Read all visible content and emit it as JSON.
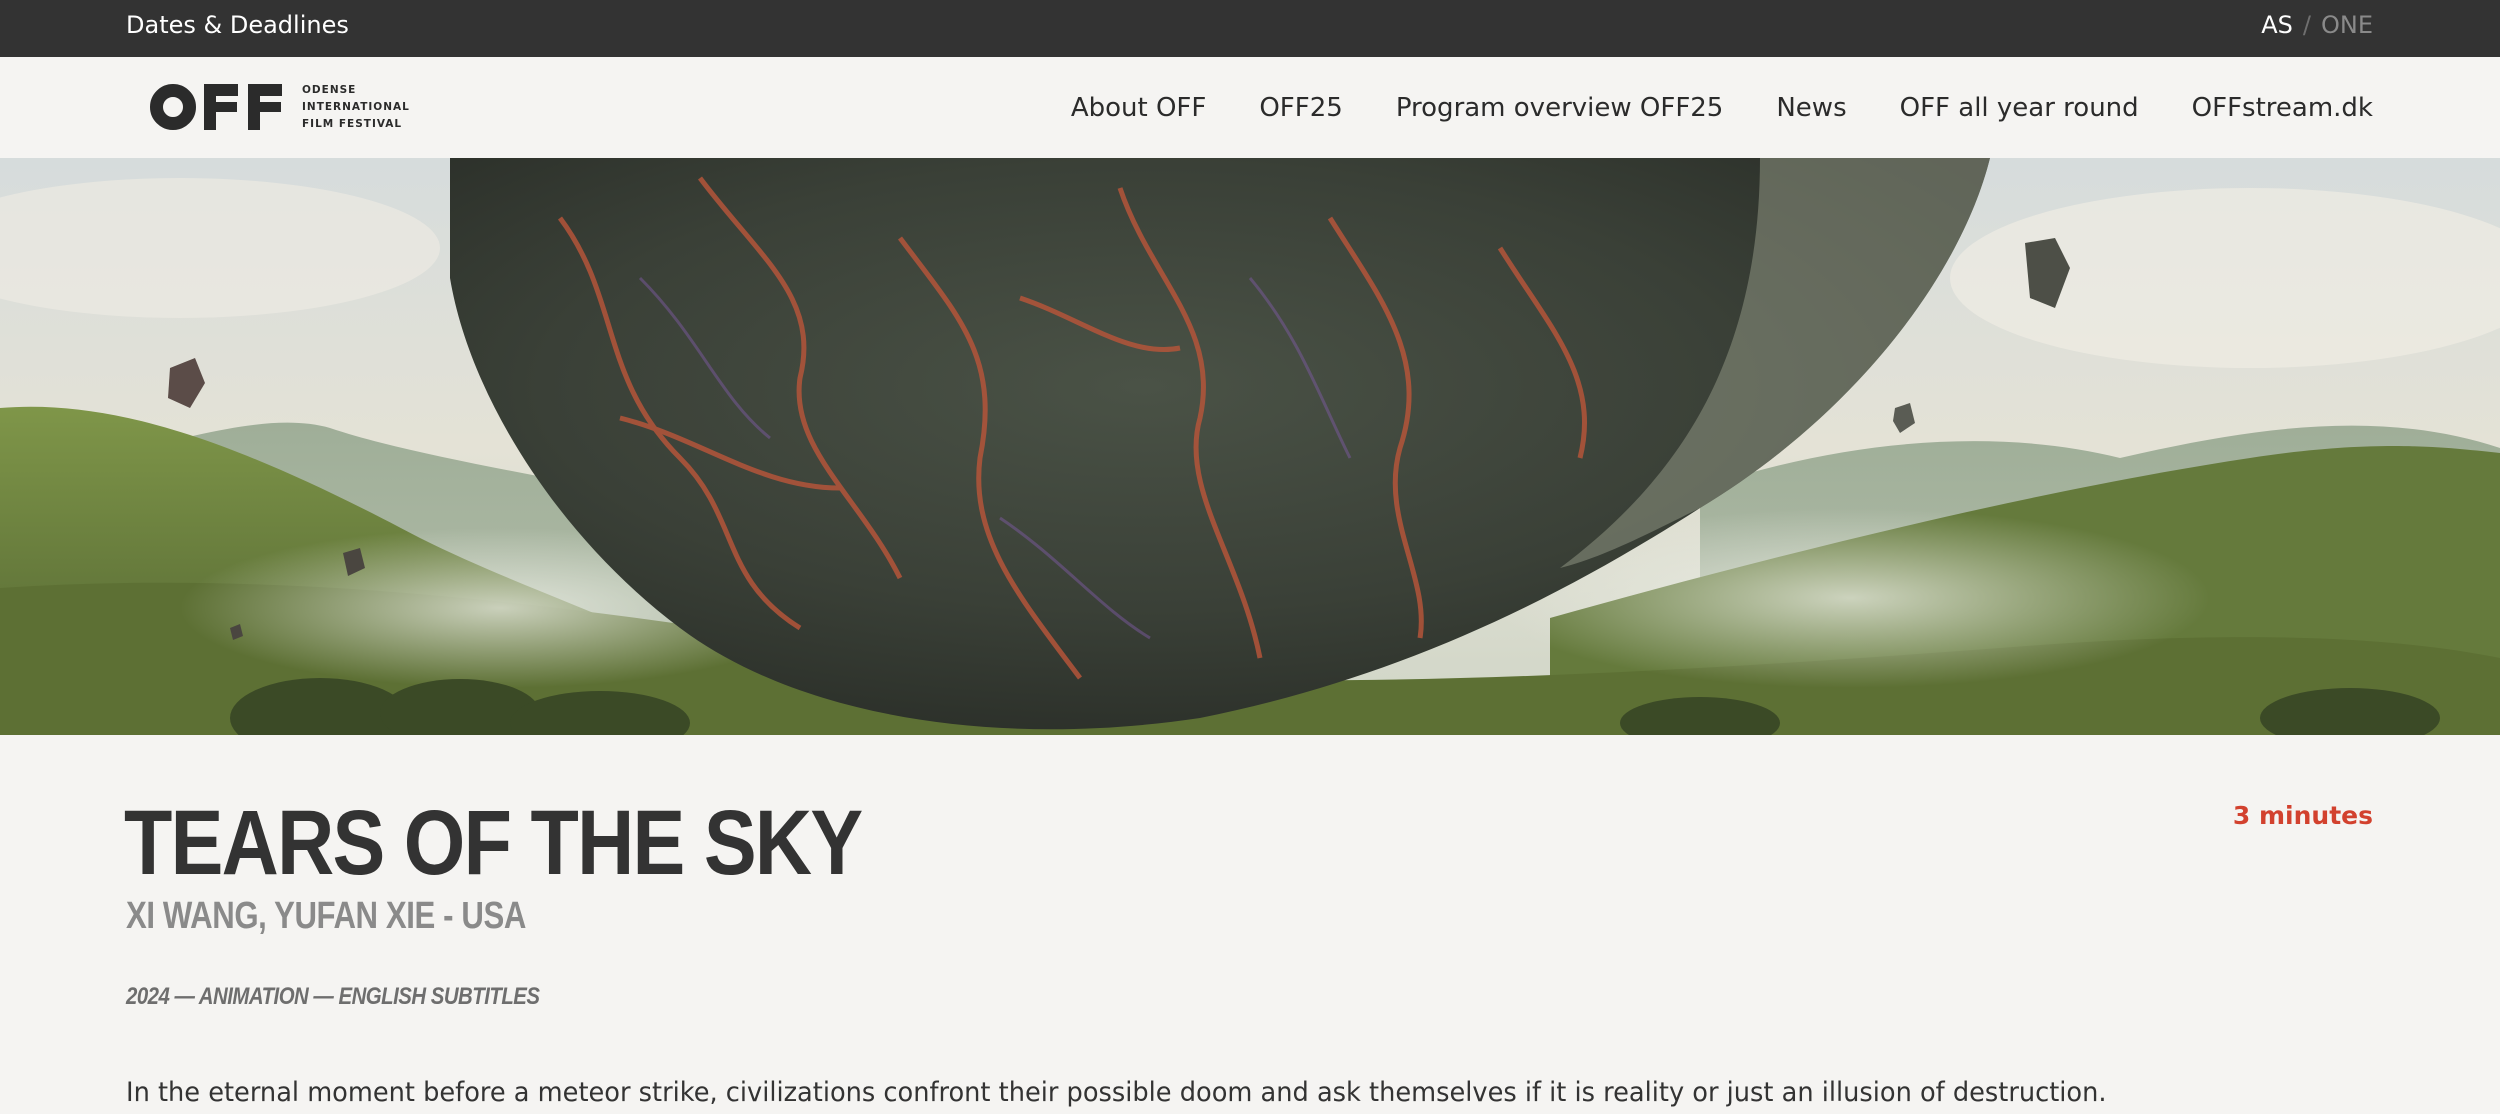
{
  "topbar": {
    "deadlines_label": "Dates & Deadlines",
    "language": {
      "active": "AS",
      "separator": "/",
      "inactive": "ONE"
    }
  },
  "header": {
    "logo": {
      "mark": "OFF",
      "line1": "ODENSE",
      "line2": "INTERNATIONAL",
      "line3": "FILM FESTIVAL"
    },
    "nav": [
      {
        "label": "About OFF"
      },
      {
        "label": "OFF25"
      },
      {
        "label": "Program overview OFF25"
      },
      {
        "label": "News"
      },
      {
        "label": "OFF all year round"
      },
      {
        "label": "OFFstream.dk"
      }
    ]
  },
  "hero": {
    "image": "hero-film-still"
  },
  "film": {
    "title": "TEARS OF THE SKY",
    "director_line": "XI WANG, YUFAN XIE - USA",
    "meta_line": "2024 — ANIMATION — ENGLISH SUBTITLES",
    "description": "In the eternal moment before a meteor strike, civilizations confront their possible doom and ask themselves if it is reality or just an illusion of destruction.",
    "duration": "3 minutes"
  },
  "colors": {
    "topbar_bg": "#333333",
    "page_bg": "#f5f4f2",
    "text": "#333333",
    "accent": "#d2412e"
  }
}
